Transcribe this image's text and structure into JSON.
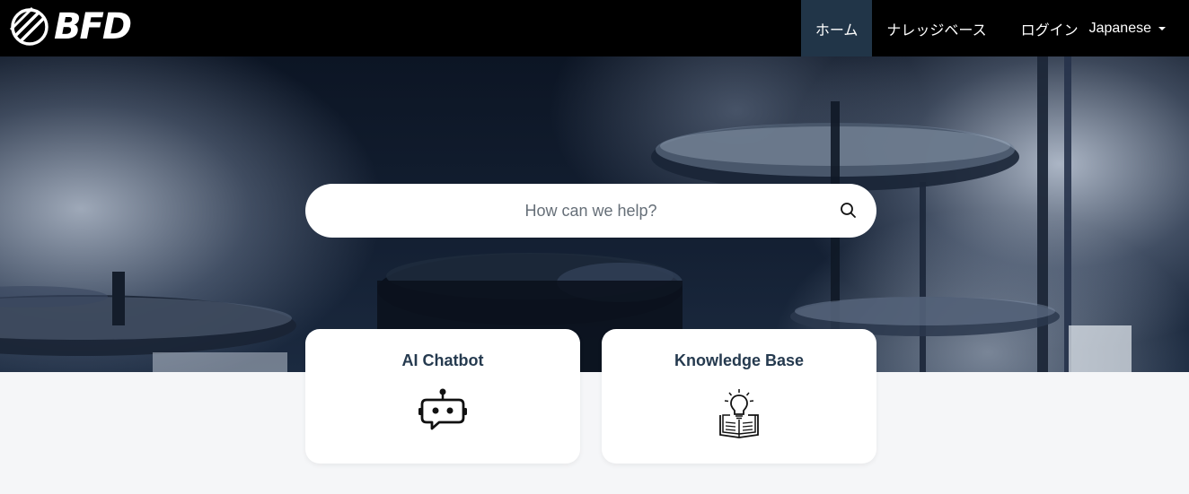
{
  "brand": {
    "logo_text": "BFD",
    "logo_icon": "bfd-logo-icon"
  },
  "nav": {
    "items": [
      {
        "label": "ホーム",
        "active": true
      },
      {
        "label": "ナレッジベース",
        "active": false
      },
      {
        "label": "ログイン",
        "active": false
      }
    ],
    "language": {
      "label": "Japanese",
      "icon": "caret-down-icon"
    },
    "active_color": "#213548"
  },
  "search": {
    "placeholder": "How can we help?",
    "value": "",
    "icon": "search-icon"
  },
  "cards": [
    {
      "title": "AI Chatbot",
      "icon": "robot-chat-icon"
    },
    {
      "title": "Knowledge Base",
      "icon": "book-lightbulb-icon"
    }
  ],
  "colors": {
    "header_bg": "#000000",
    "page_bg": "#f5f6f8",
    "card_title": "#253a4f"
  }
}
